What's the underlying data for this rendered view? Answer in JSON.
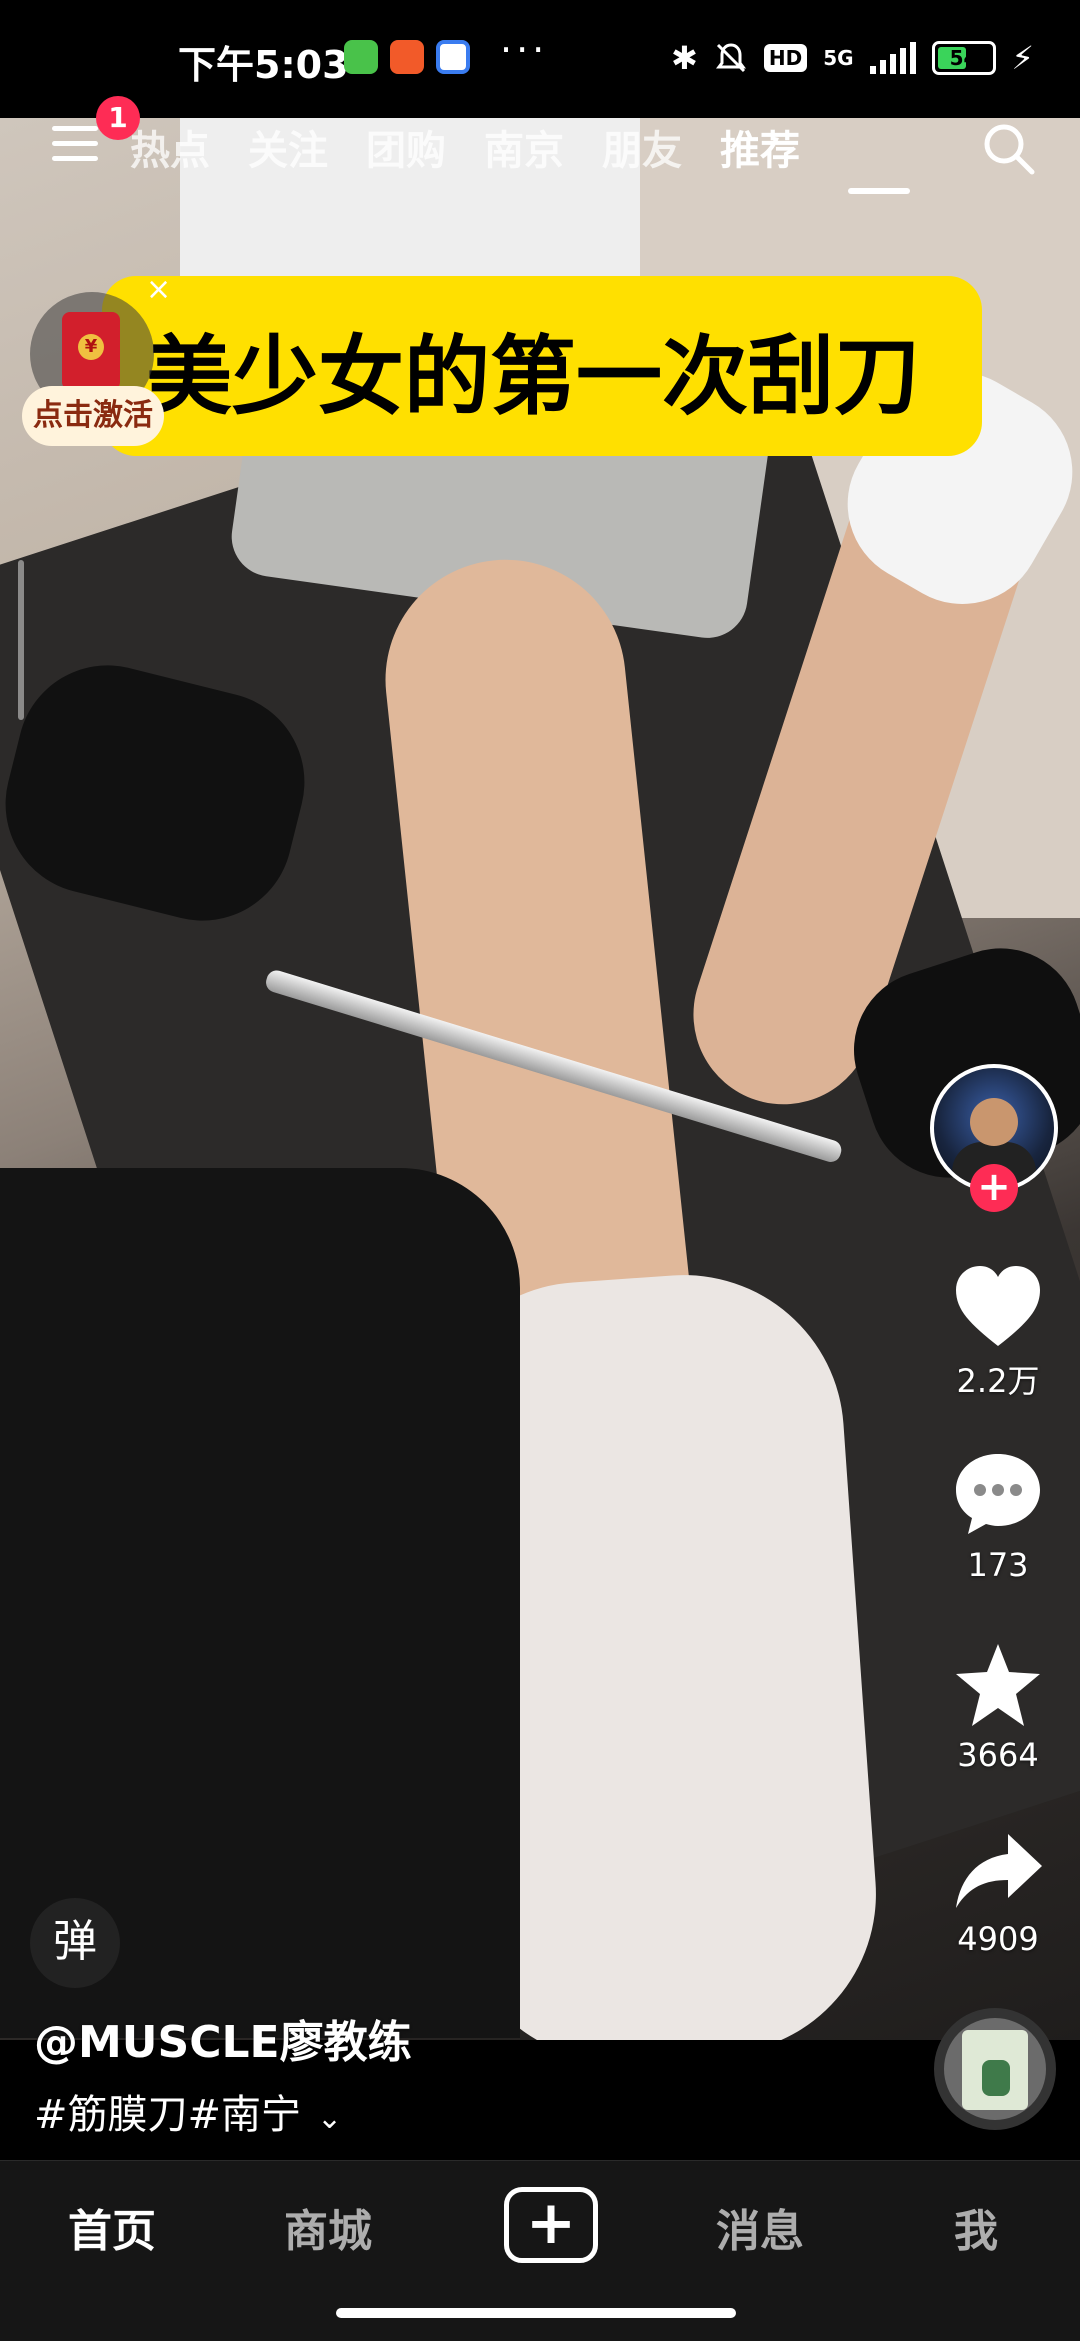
{
  "status_bar": {
    "time": "下午5:03",
    "network": "5G",
    "hd": "HD",
    "battery": 54,
    "battery_label": "54",
    "more": "···"
  },
  "top_nav": {
    "notification_count": "1",
    "tabs": [
      {
        "label": "热点",
        "active": false
      },
      {
        "label": "关注",
        "active": false
      },
      {
        "label": "团购",
        "active": false
      },
      {
        "label": "南京",
        "active": false
      },
      {
        "label": "朋友",
        "active": false
      },
      {
        "label": "推荐",
        "active": true
      }
    ]
  },
  "caption_banner": {
    "text": "美少女的第一次刮刀"
  },
  "red_packet": {
    "coin": "¥",
    "close": "×",
    "label": "点击激活"
  },
  "actions": {
    "likes": "2.2万",
    "comments": "173",
    "favorites": "3664",
    "shares": "4909",
    "follow": "+"
  },
  "video_info": {
    "danmu": "弹",
    "author": "@MUSCLE廖教练",
    "description": "#筋膜刀#南宁",
    "expand": "⌄"
  },
  "bottom_nav": {
    "home": "首页",
    "mall": "商城",
    "create": "+",
    "messages": "消息",
    "me": "我"
  },
  "colors": {
    "accent": "#fe2c55",
    "banner": "#ffe000",
    "background": "#000000"
  },
  "icons": [
    "menu-icon",
    "search-icon",
    "heart-icon",
    "comment-icon",
    "star-icon",
    "share-icon",
    "plus-icon",
    "bluetooth-icon",
    "mute-icon",
    "signal-icon",
    "charging-icon"
  ]
}
